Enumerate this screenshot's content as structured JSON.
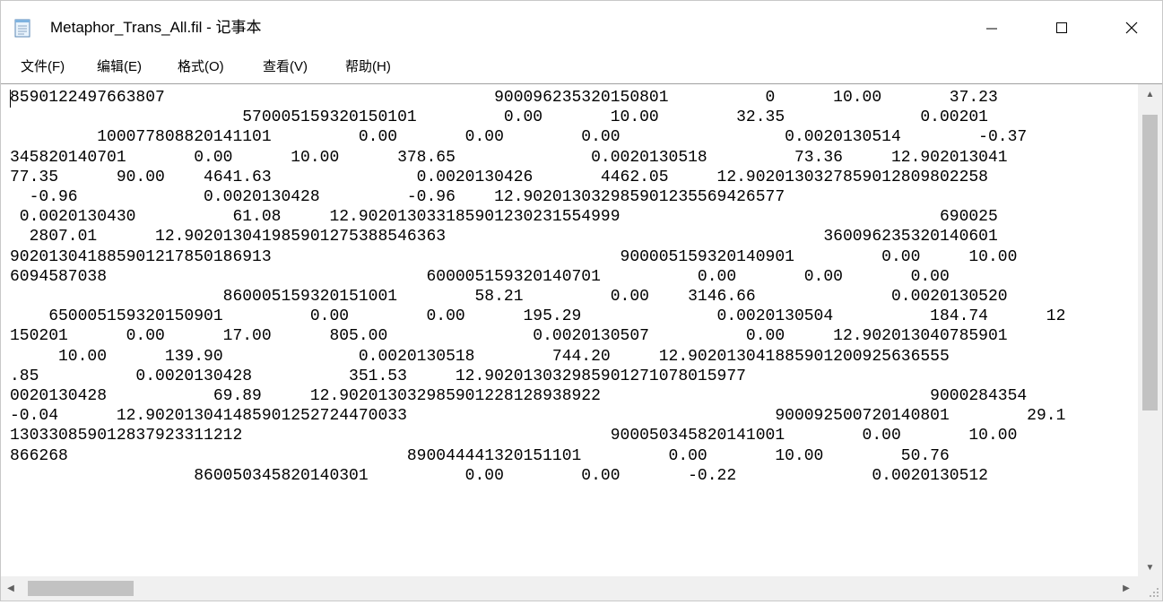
{
  "window": {
    "title": "Metaphor_Trans_All.fil - 记事本",
    "app_icon": "notepad-icon",
    "controls": {
      "minimize": "—",
      "maximize": "☐",
      "close": "✕"
    }
  },
  "menubar": {
    "items": [
      {
        "label": "文件(F)"
      },
      {
        "label": "编辑(E)"
      },
      {
        "label": "格式(O)"
      },
      {
        "label": "查看(V)"
      },
      {
        "label": "帮助(H)"
      }
    ]
  },
  "editor": {
    "lines": [
      "8590122497663807                                  900096235320150801          0      10.00       37.23",
      "                        570005159320150101         0.00       10.00        32.35              0.00201",
      "         100077808820141101         0.00       0.00        0.00                 0.0020130514        -0.37",
      "345820140701       0.00      10.00      378.65              0.0020130518         73.36     12.902013041",
      "77.35      90.00    4641.63               0.0020130426       4462.05     12.9020130327859012809802258",
      "  -0.96             0.0020130428         -0.96    12.902013032985901235569426577",
      " 0.0020130430          61.08     12.902013033185901230231554999                                 690025",
      "  2807.01      12.902013041985901275388546363                                       360096235320140601",
      "902013041885901217850186913                                    900005159320140901         0.00     10.00",
      "6094587038                                 600005159320140701          0.00       0.00       0.00",
      "                      860005159320151001        58.21         0.00    3146.66              0.0020130520",
      "    650005159320150901         0.00        0.00      195.29              0.0020130504          184.74      12",
      "150201      0.00      17.00      805.00               0.0020130507          0.00     12.902013040785901",
      "     10.00      139.90              0.0020130518        744.20     12.902013041885901200925636555",
      ".85          0.0020130428          351.53     12.902013032985901271078015977",
      "0020130428           69.89     12.902013032985901228128938922                                  9000284354",
      "-0.04      12.902013041485901252724470033                                      900092500720140801        29.1",
      "130330859012837923311212                                      900050345820141001        0.00       10.00",
      "866268                                   890044441320151101         0.00       10.00        50.76",
      "                   860050345820140301          0.00        0.00       -0.22              0.0020130512"
    ]
  },
  "scrollbars": {
    "vertical": {
      "up_icon": "▲",
      "down_icon": "▼",
      "position": 0.07
    },
    "horizontal": {
      "left_icon": "◀",
      "right_icon": "▶",
      "position": 0.0
    }
  }
}
